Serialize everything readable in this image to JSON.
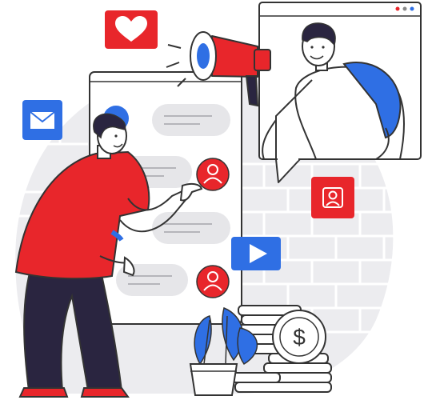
{
  "scene": {
    "coin_symbol": "$",
    "icons": [
      "heart-icon",
      "mail-icon",
      "user-icon",
      "play-icon",
      "megaphone-icon",
      "dollar-coin-icon"
    ]
  },
  "colors": {
    "accent_red": "#e8262b",
    "accent_blue": "#2f6fe4",
    "navy": "#2a2540",
    "light_gray": "#e9e9ec",
    "stroke": "#333333"
  }
}
